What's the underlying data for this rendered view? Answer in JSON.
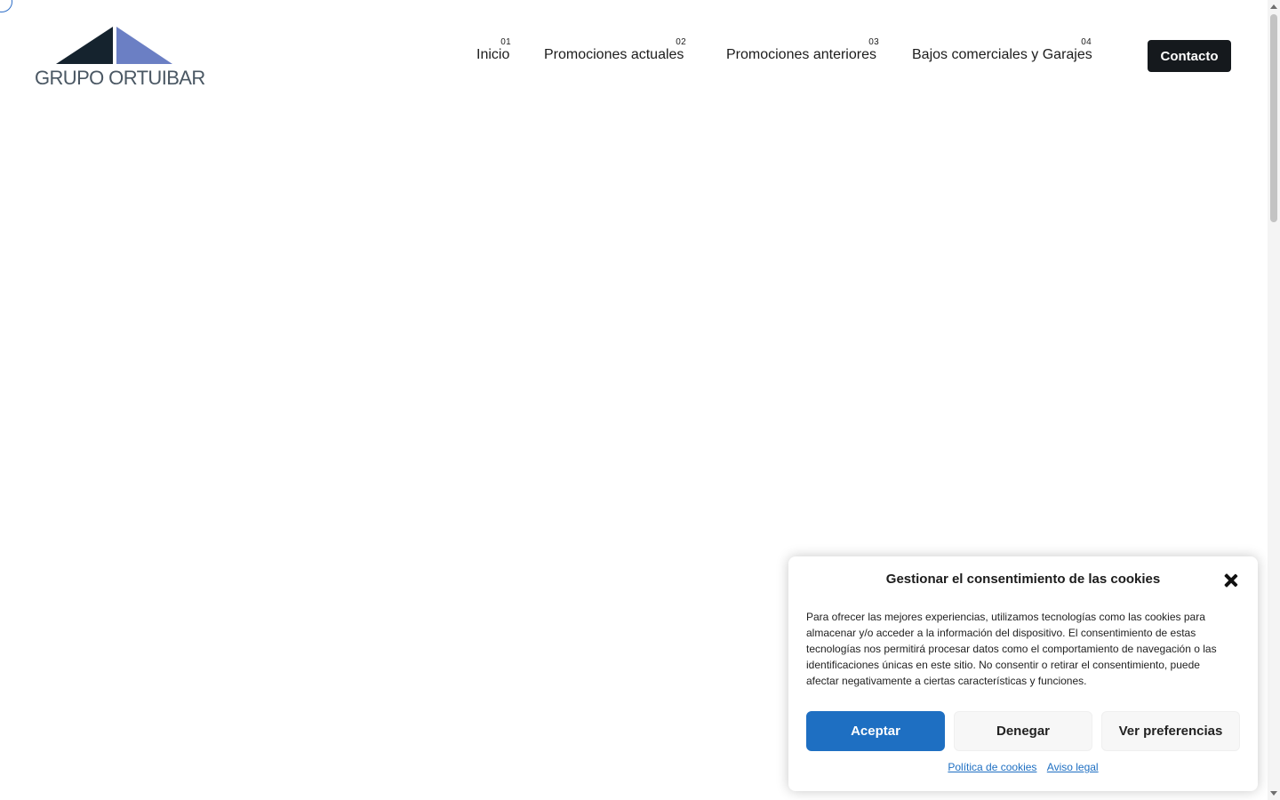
{
  "brand": {
    "name": "GRUPO ORTUIBAR",
    "colors": {
      "dark": "#15232e",
      "accent": "#6b7fc4",
      "text": "#4a5763"
    }
  },
  "nav": {
    "items": [
      {
        "num": "01",
        "label": "Inicio"
      },
      {
        "num": "02",
        "label": "Promociones actuales"
      },
      {
        "num": "03",
        "label": "Promociones anteriores"
      },
      {
        "num": "04",
        "label": "Bajos comerciales y Garajes"
      }
    ],
    "contact_label": "Contacto"
  },
  "cookie_banner": {
    "title": "Gestionar el consentimiento de las cookies",
    "close_icon": "close-icon",
    "text": "Para ofrecer las mejores experiencias, utilizamos tecnologías como las cookies para almacenar y/o acceder a la información del dispositivo. El consentimiento de estas tecnologías nos permitirá procesar datos como el comportamiento de navegación o las identificaciones únicas en este sitio. No consentir o retirar el consentimiento, puede afectar negativamente a ciertas características y funciones.",
    "accept_label": "Aceptar",
    "deny_label": "Denegar",
    "prefs_label": "Ver preferencias",
    "links": {
      "cookie_policy": "Política de cookies",
      "legal": "Aviso legal"
    },
    "colors": {
      "primary": "#1e6fc2"
    }
  }
}
